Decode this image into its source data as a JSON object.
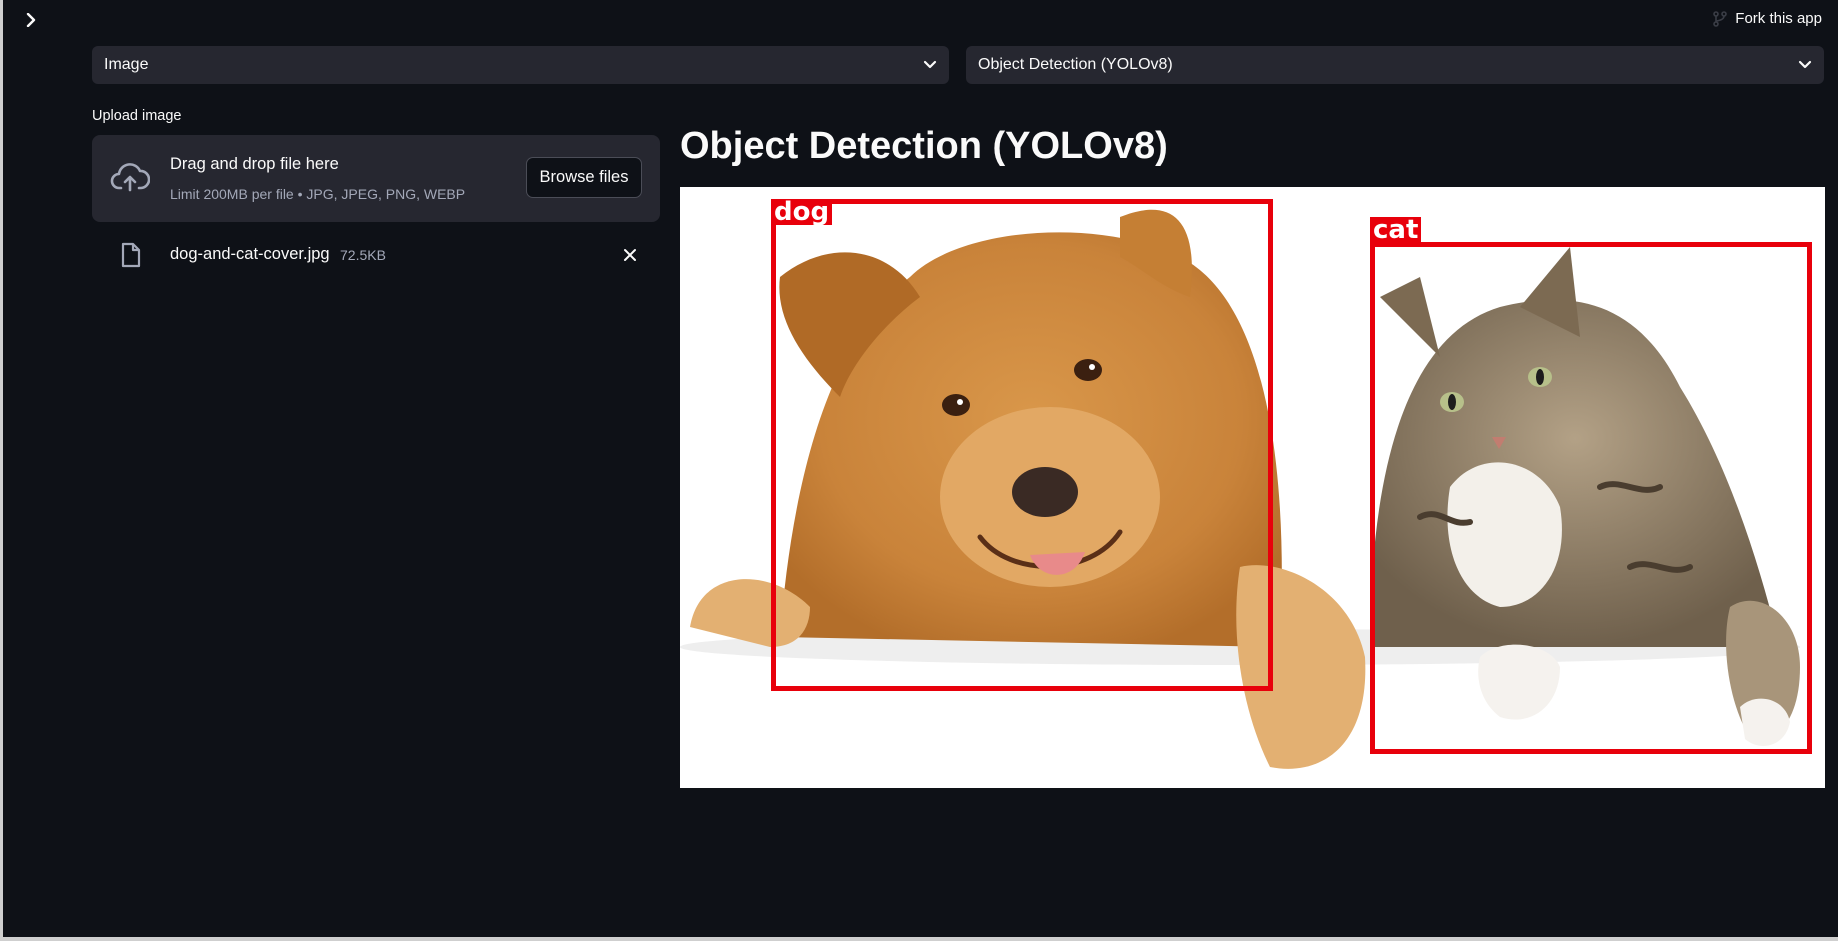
{
  "header": {
    "fork_label": "Fork this app"
  },
  "controls": {
    "mode_select": {
      "value": "Image"
    },
    "task_select": {
      "value": "Object Detection (YOLOv8)"
    }
  },
  "uploader": {
    "label": "Upload image",
    "dropzone_title": "Drag and drop file here",
    "dropzone_limit": "Limit 200MB per file • JPG, JPEG, PNG, WEBP",
    "browse_label": "Browse files",
    "file": {
      "name": "dog-and-cat-cover.jpg",
      "size": "72.5KB"
    }
  },
  "main": {
    "title": "Object Detection (YOLOv8)",
    "detections": [
      {
        "label": "dog",
        "color": "#e8000b"
      },
      {
        "label": "cat",
        "color": "#e8000b"
      }
    ]
  },
  "colors": {
    "background": "#0e1117",
    "surface": "#262730",
    "text": "#fafafa",
    "muted_text": "#a3a8b8",
    "box": "#e8000b"
  },
  "icons": {
    "sidebar_toggle": "chevron-right-icon",
    "fork": "fork-icon",
    "select_chevron": "chevron-down-icon",
    "dropzone": "cloud-upload-icon",
    "file": "file-icon",
    "remove": "close-icon"
  }
}
